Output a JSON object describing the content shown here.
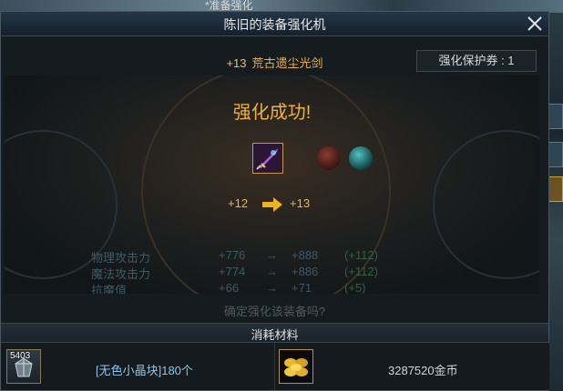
{
  "background": {
    "top_text": "*准备强化"
  },
  "window": {
    "title": "陈旧的装备强化机",
    "close_label": "×"
  },
  "item": {
    "level_prefix": "+13",
    "name": "荒古遗尘光剑"
  },
  "protection_ticket": "强化保护券 : 1",
  "result": {
    "message": "强化成功!",
    "from_level": "+12",
    "to_level": "+13"
  },
  "stats": [
    {
      "name": "物理攻击力",
      "old": "+776",
      "arrow": "→",
      "new": "+888",
      "diff": "(+112)"
    },
    {
      "name": "魔法攻击力",
      "old": "+774",
      "arrow": "→",
      "new": "+886",
      "diff": "(+112)"
    },
    {
      "name": "抗魔值",
      "old": "+66",
      "arrow": "→",
      "new": "+71",
      "diff": "(+5)"
    }
  ],
  "confirm_text": "确定强化该装备吗?",
  "materials": {
    "header": "消耗材料",
    "crystal": {
      "stock": "5403",
      "label": "[无色小晶块]180个"
    },
    "gold": {
      "label": "3287520金币"
    }
  },
  "icons": [
    "close-icon",
    "sword-item-icon",
    "right-arrow-icon",
    "crystal-icon",
    "gold-coins-icon"
  ],
  "colors": {
    "accent_gold": "#f0b24a",
    "stat_faded": "#3d5a66",
    "material_blue": "#8fc6ec"
  }
}
